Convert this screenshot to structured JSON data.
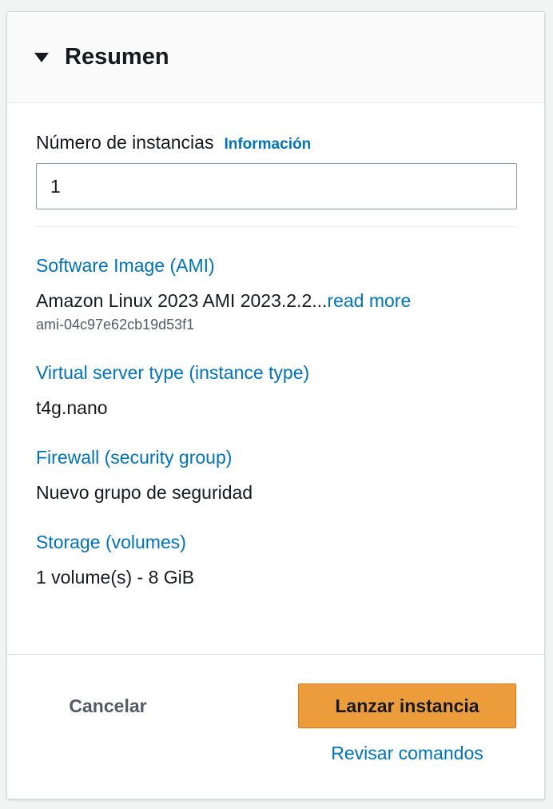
{
  "header": {
    "title": "Resumen"
  },
  "instances": {
    "label": "Número de instancias",
    "info_link": "Información",
    "value": "1"
  },
  "summary": {
    "ami": {
      "title": "Software Image (AMI)",
      "value": "Amazon Linux 2023 AMI 2023.2.2...",
      "read_more": "read more",
      "id": "ami-04c97e62cb19d53f1"
    },
    "instance_type": {
      "title": "Virtual server type (instance type)",
      "value": "t4g.nano"
    },
    "firewall": {
      "title": "Firewall (security group)",
      "value": "Nuevo grupo de seguridad"
    },
    "storage": {
      "title": "Storage (volumes)",
      "value": "1 volume(s) - 8 GiB"
    }
  },
  "footer": {
    "cancel_label": "Cancelar",
    "launch_label": "Lanzar instancia",
    "review_label": "Revisar comandos"
  },
  "colors": {
    "link": "#0073bb",
    "primary_button": "#ec9c3a",
    "text": "#16191f"
  }
}
